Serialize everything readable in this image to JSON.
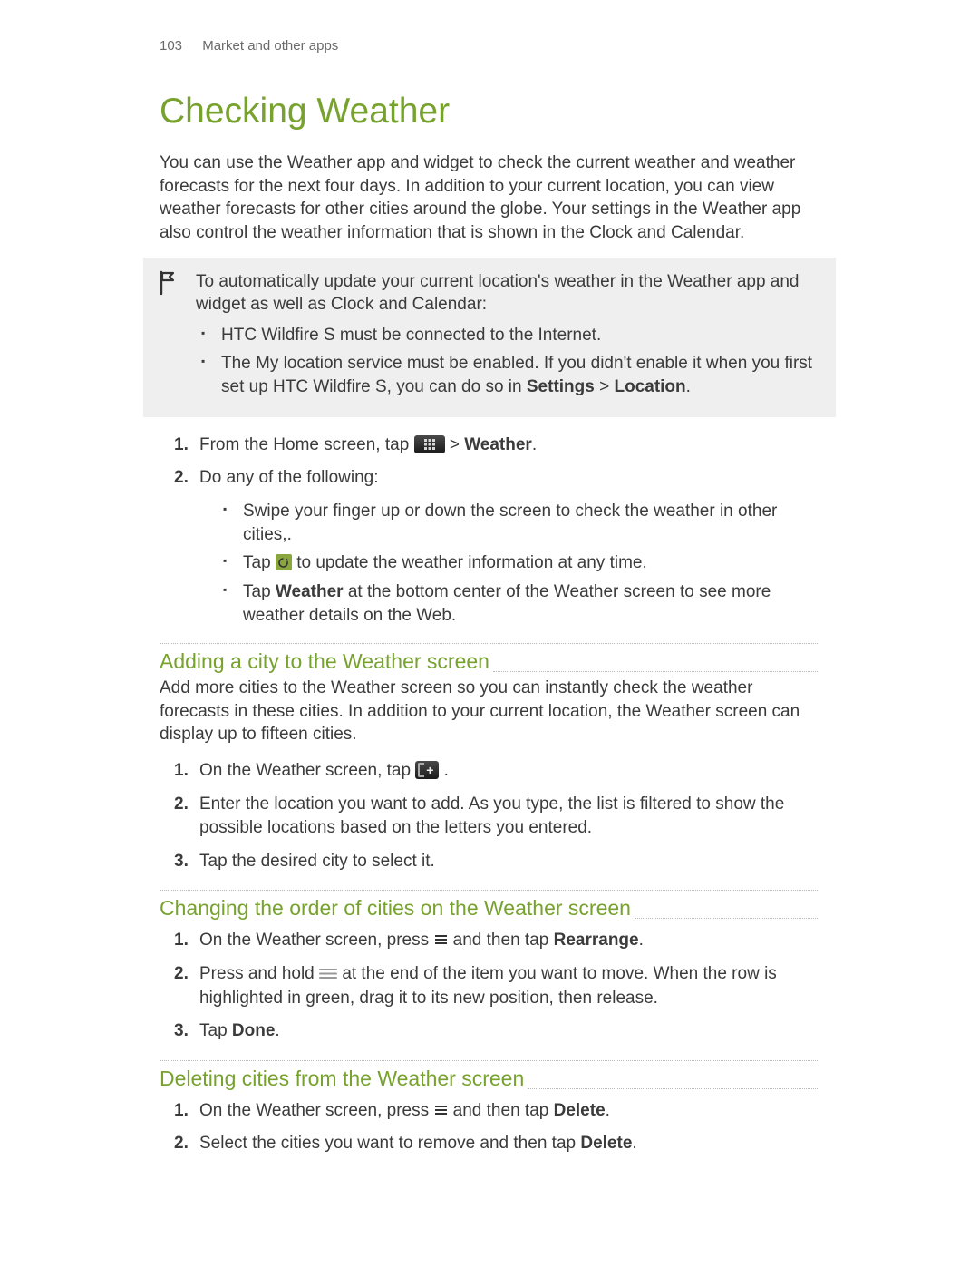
{
  "header": {
    "page_number": "103",
    "section": "Market and other apps"
  },
  "title": "Checking Weather",
  "intro": "You can use the Weather app and widget to check the current weather and weather forecasts for the next four days. In addition to your current location, you can view weather forecasts for other cities around the globe. Your settings in the Weather app also control the weather information that is shown in the Clock and Calendar.",
  "note": {
    "lead": "To automatically update your current location's weather in the Weather app and widget as well as Clock and Calendar:",
    "bullets": {
      "b1": "HTC Wildfire S must be connected to the Internet.",
      "b2_pre": "The My location service must be enabled. If you didn't enable it when you first set up HTC Wildfire S, you can do so in ",
      "b2_settings": "Settings",
      "b2_gt": " > ",
      "b2_location": "Location",
      "b2_end": "."
    }
  },
  "steps_main": {
    "s1_pre": "From the Home screen, tap ",
    "s1_gt": " > ",
    "s1_weather": "Weather",
    "s1_end": ".",
    "s2": "Do any of the following:",
    "s2_sub": {
      "a": "Swipe your finger up or down the screen to check the weather in other cities,.",
      "b_pre": "Tap ",
      "b_post": " to update the weather information at any time.",
      "c_pre": "Tap ",
      "c_bold": "Weather",
      "c_post": " at the bottom center of the Weather screen to see more weather details on the Web."
    }
  },
  "adding": {
    "title": "Adding a city to the Weather screen",
    "intro": "Add more cities to the Weather screen so you can instantly check the weather forecasts in these cities. In addition to your current location, the Weather screen can display up to fifteen cities.",
    "steps": {
      "s1_pre": "On the Weather screen, tap ",
      "s1_end": ".",
      "s2": "Enter the location you want to add. As you type, the list is filtered to show the possible locations based on the letters you entered.",
      "s3": "Tap the desired city to select it."
    }
  },
  "changing": {
    "title": "Changing the order of cities on the Weather screen",
    "steps": {
      "s1_pre": "On the Weather screen, press ",
      "s1_mid": " and then tap ",
      "s1_bold": "Rearrange",
      "s1_end": ".",
      "s2_pre": "Press and hold ",
      "s2_post": " at the end of the item you want to move. When the row is highlighted in green, drag it to its new position, then release.",
      "s3_pre": "Tap ",
      "s3_bold": "Done",
      "s3_end": "."
    }
  },
  "deleting": {
    "title": "Deleting cities from the Weather screen",
    "steps": {
      "s1_pre": "On the Weather screen, press ",
      "s1_mid": " and then tap ",
      "s1_bold": "Delete",
      "s1_end": ".",
      "s2_pre": "Select the cities you want to remove and then tap ",
      "s2_bold": "Delete",
      "s2_end": "."
    }
  },
  "nums": {
    "n1": "1.",
    "n2": "2.",
    "n3": "3."
  }
}
